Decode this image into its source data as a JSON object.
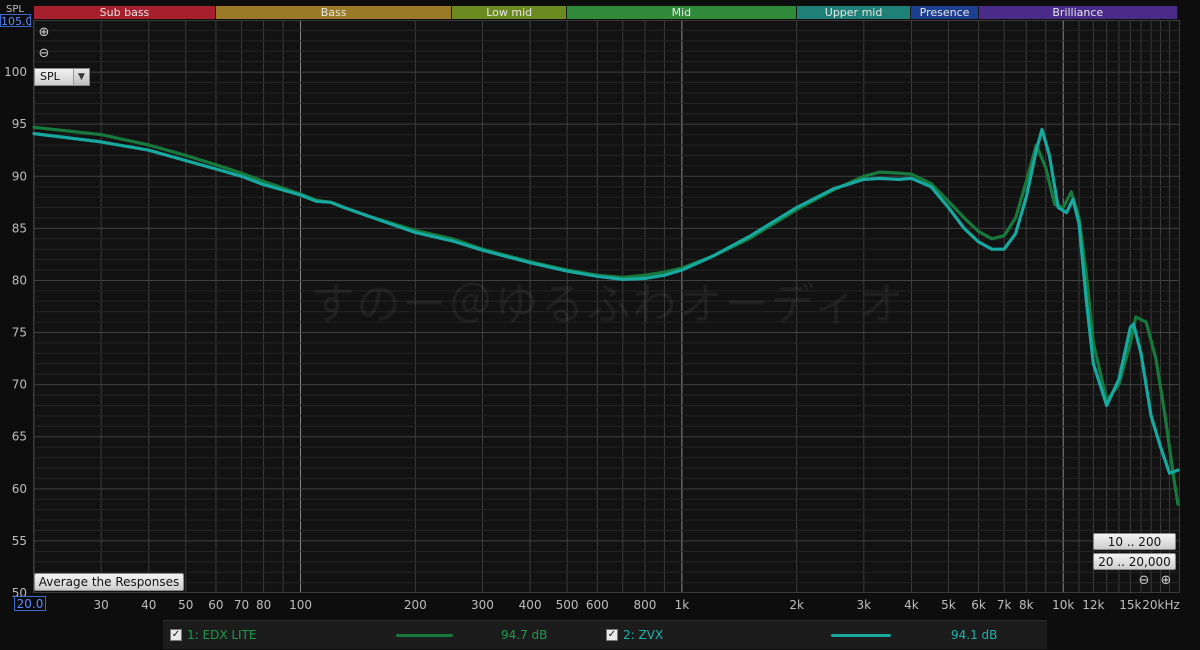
{
  "bands": [
    {
      "label": "Sub bass",
      "from": 20,
      "to": 60,
      "color": "#a51f2c"
    },
    {
      "label": "Bass",
      "from": 60,
      "to": 250,
      "color": "#9a7a26"
    },
    {
      "label": "Low mid",
      "from": 250,
      "to": 500,
      "color": "#6b8a20"
    },
    {
      "label": "Mid",
      "from": 500,
      "to": 2000,
      "color": "#2f8a3a"
    },
    {
      "label": "Upper mid",
      "from": 2000,
      "to": 4000,
      "color": "#1f8077"
    },
    {
      "label": "Presence",
      "from": 4000,
      "to": 6000,
      "color": "#1d3f8f"
    },
    {
      "label": "Brilliance",
      "from": 6000,
      "to": 20000,
      "color": "#4a2b8a"
    }
  ],
  "top_unit_label": "SPL",
  "ymax_box": "105.00",
  "ymin_box": "20.0",
  "measure_select": "SPL",
  "average_button": "Average the Responses",
  "range_buttons": [
    "10 .. 200",
    "20 .. 20,000"
  ],
  "watermark": "すのー＠ゆるふわオーディオ",
  "legend": [
    {
      "name": "1: EDX LITE",
      "value": "94.7 dB",
      "color": "#17793c",
      "text_color": "#1e9a4c"
    },
    {
      "name": "2: ZVX",
      "value": "94.1 dB",
      "color": "#17a8a0",
      "text_color": "#1cb2ad"
    }
  ],
  "chart_data": {
    "type": "line",
    "title": "",
    "xlabel": "",
    "ylabel": "SPL",
    "x_scale": "log",
    "xlim": [
      20,
      20000
    ],
    "ylim": [
      50,
      105
    ],
    "grid": true,
    "x_ticks": [
      {
        "v": 20,
        "label": ""
      },
      {
        "v": 30,
        "label": "30"
      },
      {
        "v": 40,
        "label": "40"
      },
      {
        "v": 50,
        "label": "50"
      },
      {
        "v": 60,
        "label": "60"
      },
      {
        "v": 70,
        "label": "70"
      },
      {
        "v": 80,
        "label": "80"
      },
      {
        "v": 100,
        "label": "100"
      },
      {
        "v": 200,
        "label": "200"
      },
      {
        "v": 300,
        "label": "300"
      },
      {
        "v": 400,
        "label": "400"
      },
      {
        "v": 500,
        "label": "500"
      },
      {
        "v": 600,
        "label": "600"
      },
      {
        "v": 800,
        "label": "800"
      },
      {
        "v": 1000,
        "label": "1k"
      },
      {
        "v": 2000,
        "label": "2k"
      },
      {
        "v": 3000,
        "label": "3k"
      },
      {
        "v": 4000,
        "label": "4k"
      },
      {
        "v": 5000,
        "label": "5k"
      },
      {
        "v": 6000,
        "label": "6k"
      },
      {
        "v": 7000,
        "label": "7k"
      },
      {
        "v": 8000,
        "label": "8k"
      },
      {
        "v": 10000,
        "label": "10k"
      },
      {
        "v": 12000,
        "label": "12k"
      },
      {
        "v": 15000,
        "label": "15k"
      },
      {
        "v": 20000,
        "label": "20kHz"
      }
    ],
    "y_ticks": [
      55,
      60,
      65,
      70,
      75,
      80,
      85,
      90,
      95,
      100
    ],
    "series": [
      {
        "name": "1: EDX LITE",
        "color": "#17793c",
        "points": [
          [
            20,
            94.7
          ],
          [
            30,
            94.0
          ],
          [
            40,
            93.0
          ],
          [
            50,
            92.0
          ],
          [
            60,
            91.1
          ],
          [
            70,
            90.3
          ],
          [
            80,
            89.5
          ],
          [
            100,
            88.3
          ],
          [
            110,
            87.7
          ],
          [
            120,
            87.5
          ],
          [
            130,
            87.0
          ],
          [
            150,
            86.2
          ],
          [
            200,
            84.8
          ],
          [
            250,
            84.0
          ],
          [
            300,
            83.0
          ],
          [
            400,
            81.8
          ],
          [
            500,
            81.0
          ],
          [
            600,
            80.5
          ],
          [
            700,
            80.3
          ],
          [
            800,
            80.5
          ],
          [
            900,
            80.8
          ],
          [
            1000,
            81.2
          ],
          [
            1200,
            82.3
          ],
          [
            1500,
            84.0
          ],
          [
            2000,
            86.8
          ],
          [
            2500,
            88.7
          ],
          [
            3000,
            90.0
          ],
          [
            3300,
            90.4
          ],
          [
            3700,
            90.3
          ],
          [
            4000,
            90.2
          ],
          [
            4500,
            89.3
          ],
          [
            5000,
            87.6
          ],
          [
            5500,
            86.0
          ],
          [
            6000,
            84.7
          ],
          [
            6500,
            84.0
          ],
          [
            7000,
            84.3
          ],
          [
            7500,
            86.0
          ],
          [
            8000,
            89.5
          ],
          [
            8500,
            93.0
          ],
          [
            9000,
            90.8
          ],
          [
            9500,
            87.3
          ],
          [
            10000,
            87.0
          ],
          [
            10500,
            88.5
          ],
          [
            11000,
            86.0
          ],
          [
            11500,
            80.5
          ],
          [
            12000,
            74.0
          ],
          [
            13000,
            68.5
          ],
          [
            14000,
            70.0
          ],
          [
            15000,
            74.0
          ],
          [
            15500,
            76.5
          ],
          [
            16500,
            76.0
          ],
          [
            17500,
            72.5
          ],
          [
            18500,
            67.0
          ],
          [
            19500,
            61.0
          ],
          [
            20000,
            58.5
          ]
        ]
      },
      {
        "name": "2: ZVX",
        "color": "#17a8a0",
        "points": [
          [
            20,
            94.1
          ],
          [
            30,
            93.3
          ],
          [
            40,
            92.5
          ],
          [
            50,
            91.5
          ],
          [
            60,
            90.7
          ],
          [
            70,
            90.0
          ],
          [
            80,
            89.2
          ],
          [
            100,
            88.2
          ],
          [
            110,
            87.6
          ],
          [
            120,
            87.5
          ],
          [
            130,
            87.0
          ],
          [
            150,
            86.2
          ],
          [
            200,
            84.6
          ],
          [
            250,
            83.8
          ],
          [
            300,
            82.9
          ],
          [
            400,
            81.7
          ],
          [
            500,
            80.9
          ],
          [
            600,
            80.4
          ],
          [
            700,
            80.1
          ],
          [
            800,
            80.2
          ],
          [
            900,
            80.5
          ],
          [
            1000,
            81.0
          ],
          [
            1200,
            82.3
          ],
          [
            1500,
            84.2
          ],
          [
            2000,
            87.0
          ],
          [
            2500,
            88.8
          ],
          [
            3000,
            89.7
          ],
          [
            3300,
            89.8
          ],
          [
            3700,
            89.7
          ],
          [
            4000,
            89.8
          ],
          [
            4500,
            89.0
          ],
          [
            5000,
            87.0
          ],
          [
            5500,
            85.0
          ],
          [
            6000,
            83.7
          ],
          [
            6500,
            83.0
          ],
          [
            7000,
            83.0
          ],
          [
            7500,
            84.5
          ],
          [
            8000,
            88.0
          ],
          [
            8500,
            92.5
          ],
          [
            8800,
            94.5
          ],
          [
            9200,
            92.0
          ],
          [
            9700,
            87.0
          ],
          [
            10200,
            86.5
          ],
          [
            10600,
            87.8
          ],
          [
            11000,
            85.5
          ],
          [
            11500,
            78.0
          ],
          [
            12000,
            72.0
          ],
          [
            13000,
            68.0
          ],
          [
            14000,
            70.5
          ],
          [
            15000,
            75.5
          ],
          [
            15300,
            75.8
          ],
          [
            16000,
            73.0
          ],
          [
            17000,
            67.0
          ],
          [
            18000,
            64.0
          ],
          [
            19000,
            61.5
          ],
          [
            20000,
            61.8
          ]
        ]
      }
    ]
  }
}
